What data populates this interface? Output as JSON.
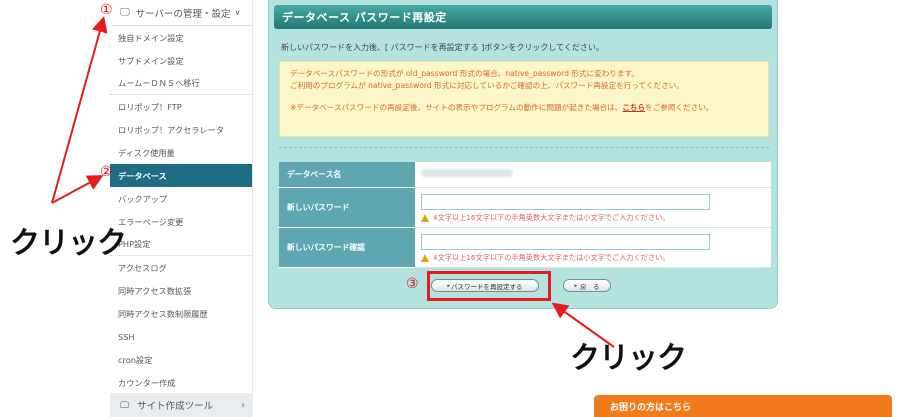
{
  "sidebar": {
    "section_title": "サーバーの管理・設定",
    "items": [
      {
        "label": "独自ドメイン設定"
      },
      {
        "label": "サブドメイン設定"
      },
      {
        "label": "ムームーＤＮＳへ移行"
      },
      {
        "label": "ロリポップ！FTP"
      },
      {
        "label": "ロリポップ！アクセラレータ"
      },
      {
        "label": "ディスク使用量"
      },
      {
        "label": "データベース"
      },
      {
        "label": "バックアップ"
      },
      {
        "label": "エラーページ変更"
      },
      {
        "label": "PHP設定"
      },
      {
        "label": "アクセスログ"
      },
      {
        "label": "同時アクセス数拡張"
      },
      {
        "label": "同時アクセス数制限履歴"
      },
      {
        "label": "SSH"
      },
      {
        "label": "cron設定"
      },
      {
        "label": "カウンター作成"
      }
    ],
    "footer_section": "サイト作成ツール"
  },
  "panel": {
    "title": "データベース パスワード再設定",
    "intro": "新しいパスワードを入力後、[ パスワードを再設定する ]ボタンをクリックしてください。",
    "warning_line1": "データベースパスワードの形式が old_password 形式の場合、native_password 形式に変わります。",
    "warning_line2": "ご利用のプログラムが native_password 形式に対応しているかご確認の上、パスワード再設定を行ってください。",
    "warning_line3_pre": "※データベースパスワードの再設定後、サイトの表示やプログラムの動作に問題が起きた場合は、",
    "warning_link": "こちら",
    "warning_line3_post": "をご参照ください。",
    "form": {
      "db_name_label": "データベース名",
      "new_password_label": "新しいパスワード",
      "new_password_hint": "4文字以上16文字以下の半角英数大文字または小文字でご入力ください。",
      "confirm_password_label": "新しいパスワード確認",
      "confirm_password_hint": "4文字以上16文字以下の半角英数大文字または小文字でご入力ください。"
    },
    "submit_label": "パスワードを再設定する",
    "back_label": "戻　る"
  },
  "annotations": {
    "step1": "①",
    "step2": "②",
    "step3": "③",
    "click_left": "クリック",
    "click_right": "クリック"
  },
  "help_button": "お困りの方はこちら",
  "colors": {
    "accent_teal": "#1f6d85",
    "panel_bg": "#b4e2de",
    "warning_text": "#d56a2a",
    "annotation_red": "#e41c1c",
    "help_orange": "#f07b1d"
  }
}
